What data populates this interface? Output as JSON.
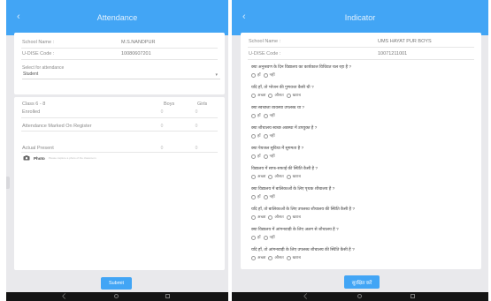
{
  "attendance": {
    "title": "Attendance",
    "school_name_label": "School Name :",
    "school_name_value": "M.S.NANDPUR",
    "udise_label": "U-DISE Code :",
    "udise_value": "10080607201",
    "select_label": "Select for attendance",
    "select_value": "Student",
    "class_label": "Class 6 - 8",
    "boys_label": "Boys",
    "girls_label": "Girls",
    "enrolled_label": "Enrolled",
    "enrolled_boys": "0",
    "enrolled_girls": "0",
    "register_label": "Attendance Marked On Register",
    "register_boys": "0",
    "register_girls": "0",
    "actual_label": "Actual Present",
    "actual_boys": "0",
    "actual_girls": "0",
    "photo_label": "Photo",
    "photo_hint": "Please capture a photo of the classroom",
    "submit_label": "Submit"
  },
  "indicator": {
    "title": "Indicator",
    "school_name_label": "School Name :",
    "school_name_value": "UMS HAYAT PUR BOYS",
    "udise_label": "U-DISE Code :",
    "udise_value": "10071211001",
    "questions": [
      {
        "text": "क्या अनुश्रवण के दिन विद्यालय का कार्यकाल विधिवत चल रहा है ?",
        "options": [
          "हाँ",
          "नहीं"
        ]
      },
      {
        "text": "यदि हाँ, तो भोजन की गुणवत्ता कैसी थी ?",
        "options": [
          "अच्छा",
          "औसत",
          "खराब"
        ]
      },
      {
        "text": "क्या स्वच्छता व्यवस्था उपलब्ध था ?",
        "options": [
          "हाँ",
          "नहीं"
        ]
      },
      {
        "text": "क्या शौचालय स्वच्छ अवस्था में उपयुक्त है ?",
        "options": [
          "हाँ",
          "नहीं"
        ]
      },
      {
        "text": "क्या पेयजल सुविधा में सुगमता है ?",
        "options": [
          "हाँ",
          "नहीं"
        ]
      },
      {
        "text": "विद्यालय में साफ-सफाई की स्थिति कैसी है ?",
        "options": [
          "अच्छा",
          "औसत",
          "खराब"
        ]
      },
      {
        "text": "क्या विद्यालय में बालिकाओं के लिए पृथक शौचालय है ?",
        "options": [
          "हाँ",
          "नहीं"
        ]
      },
      {
        "text": "यदि हाँ, तो बालिकाओं के लिए उपलब्ध शौचालय की स्थिति कैसी है ?",
        "options": [
          "अच्छा",
          "औसत",
          "खराब"
        ]
      },
      {
        "text": "क्या विद्यालय में आंगनवाड़ी के लिए अलग से शौचालय है ?",
        "options": [
          "हाँ",
          "नहीं"
        ]
      },
      {
        "text": "यदि हाँ, तो आंगनवाड़ी के लिए उपलब्ध शौचालय की स्थिति कैसी है ?",
        "options": [
          "अच्छा",
          "औसत",
          "खराब"
        ]
      }
    ],
    "submit_label": "सुरक्षित करें"
  }
}
